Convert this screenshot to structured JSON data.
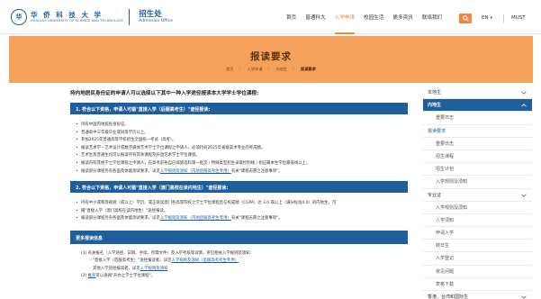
{
  "header": {
    "logo_seal": "华",
    "logo_cn": "华 侨 科 技 大 学",
    "logo_en": "HUAQIAO UNIVERSITY OF SCIENCE AND TECHNOLOGY",
    "office_cn": "招生处",
    "office_en": "Admission Office",
    "nav": [
      "首页",
      "普通科大",
      "入学申请",
      "校园生活",
      "更多资讯",
      "联络我们"
    ],
    "active_nav_index": 2,
    "lang_label": "EN",
    "lang_caret": "▾",
    "must_label": "MUST",
    "accent_color": "#f08a3c",
    "search_icon": "search-icon"
  },
  "banner": {
    "title": "报读要求",
    "breadcrumb": [
      "首页",
      "入学申请",
      "内地生",
      "报读要求"
    ],
    "background": "#f4a25b"
  },
  "main": {
    "intro": "持内地居民身份证的申请人可以选择以下其中一种入学途径报读本大学学士学位课程:",
    "section1_title": "1. 符合以下资格，申请人可循\"直接入学（后服高考生）\"途径报读:",
    "section1_bullets": [
      "持有中国内地居民身份证。",
      "普通高中三年级毕业或同等学历以上。",
      "参加2025年普通高等学校招生全国统一考试（高考）。",
      "报读艺术学－艺术设计或数字媒体艺术学士学位课程之申请人，必须持有2025年省级美术专业的考成绩。",
      "艺术生及普通生均可以报读所有其余课程及开放艺术学士学位课程。",
      "报读内有其他学士学位课程之申请人，在高考前各自已保留选科第一批次 / 特殊类型招生录取控制线 / 相应最本生学位最低线以上。"
    ],
    "section1_last_prefix": "报读部分课程另有各面及体能测试要求，详见",
    "section1_last_link": "入学规则及须知（内地后服高考生专用）",
    "section1_last_suffix": "有关\"课程志愿之注意事项\"。",
    "section2_title": "2. 符合以下资格，申请人可循\"直接入学（澳门高校在读内地生）\"途径报读:",
    "section2_bullets": [
      "持有中小或和等视规（或以上）学历，或正就读澳门各高等院校之学士学位课程且在校成绩（CGPA）达 3.0 或以上（满分标准4.0）的内地生，可",
      "循\"直接入学（澳门高校在读内地生）\"途径报读。"
    ],
    "section2_last_prefix": "报读部分课程另有各面及体能测试要求，详见",
    "section2_last_link": "入学规则及须知（内地后服高考生专用）",
    "section2_last_suffix": "有关\"课程志愿之注意事项\"。",
    "section3_title": "更多报读信息",
    "numbered": [
      {
        "text": "(1) 有关报名（入学途径、日期、手续、所需文件）及入学考核等详情，参见相关入学规则及须知:",
        "sub": false
      },
      {
        "text": "- \"直接入学（后服高考生）\"途径报读者，详见",
        "link": "入学规则及须知（后服高考考生专用）",
        "sub": true
      },
      {
        "text": "- 其他入学途径报读者，详见",
        "link": "入学规则及须知",
        "sub": true
      },
      {
        "text": "(2) ",
        "link": "推荐",
        "suffix": "可以查阅\"开办之学士学位课程\"。",
        "sub": false
      }
    ],
    "section_color": "#1f5e9d"
  },
  "sidebar": {
    "rows": [
      {
        "label": "本地生",
        "type": "group",
        "chevron": "chevron-down-icon"
      },
      {
        "label": "内地生",
        "type": "active-group",
        "chevron": "chevron-up-icon"
      },
      {
        "label": "重要日志",
        "type": "sub"
      },
      {
        "label": "报读要求",
        "type": "active-item"
      },
      {
        "label": "重要日志",
        "type": "sub"
      },
      {
        "label": "招生课程",
        "type": "sub"
      },
      {
        "label": "招生计划",
        "type": "sub"
      },
      {
        "label": "入学规则及须知",
        "type": "sub"
      },
      {
        "label": "专业证",
        "type": "group",
        "chevron": "chevron-down-icon"
      },
      {
        "label": "入学规则及须知",
        "type": "sub"
      },
      {
        "label": "入学须知",
        "type": "sub"
      },
      {
        "label": "申请入学",
        "type": "sub"
      },
      {
        "label": "转日生",
        "type": "sub"
      },
      {
        "label": "入学登记",
        "type": "sub"
      },
      {
        "label": "常见问题",
        "type": "sub"
      },
      {
        "label": "表格下载",
        "type": "sub"
      },
      {
        "label": "香港、台湾和国际生",
        "type": "group",
        "chevron": "chevron-down-icon"
      }
    ]
  }
}
